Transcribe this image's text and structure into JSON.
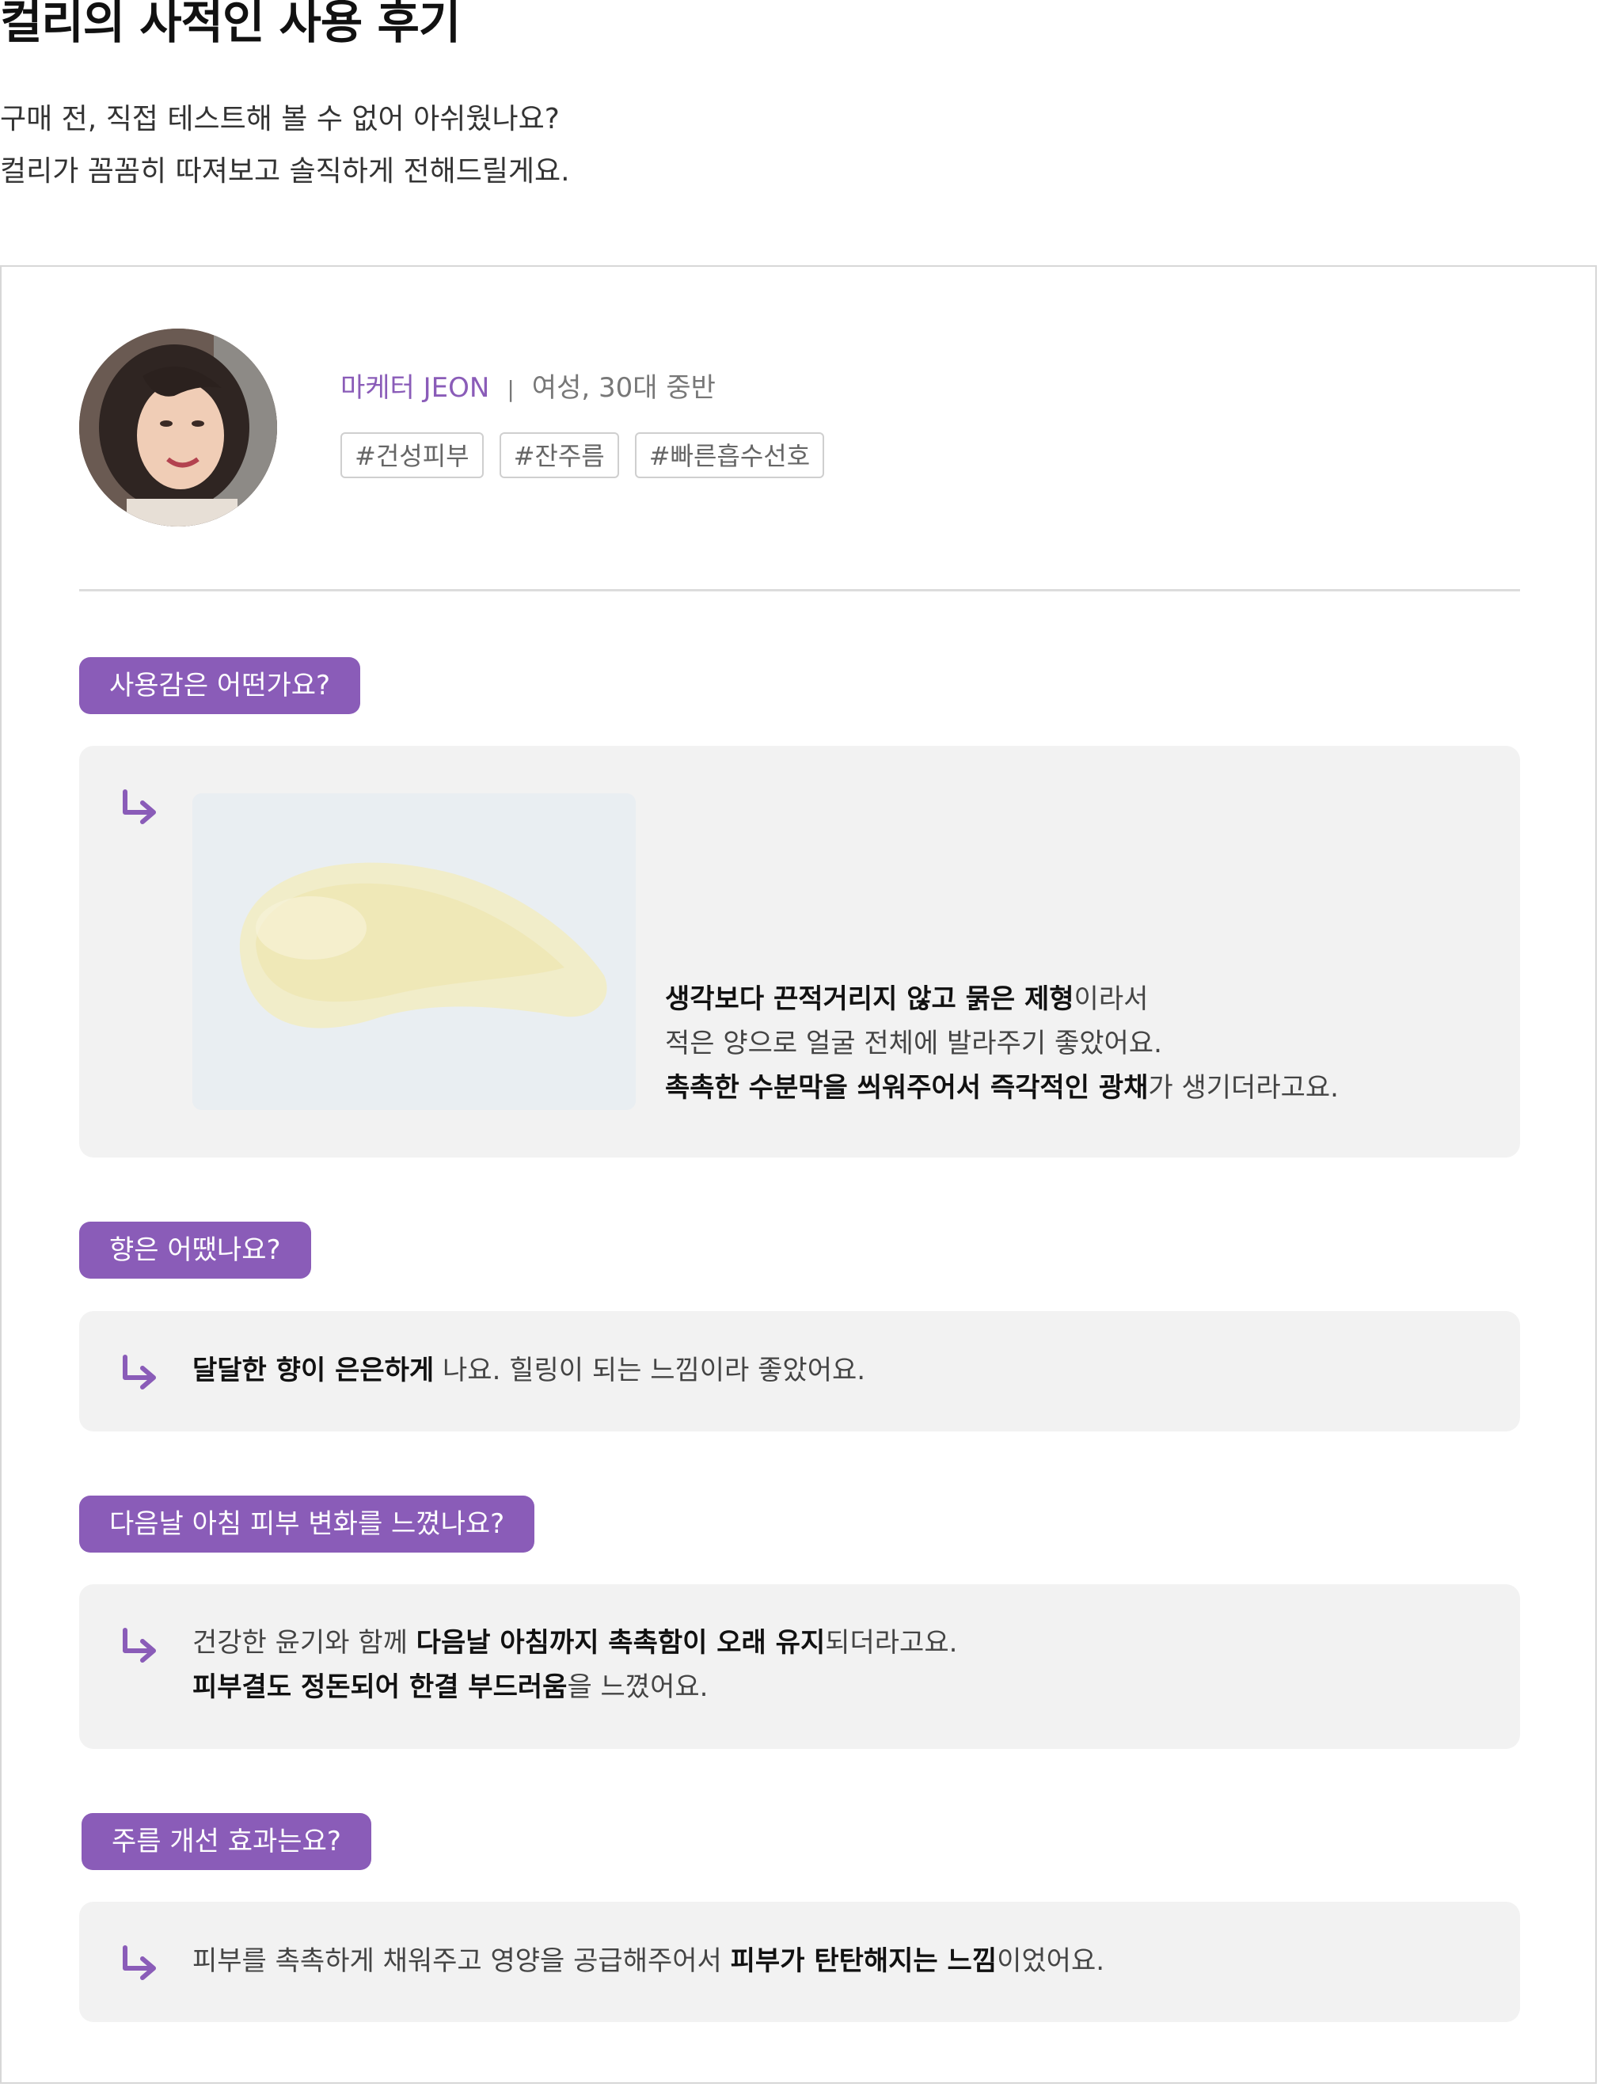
{
  "page": {
    "title": "컬리의 사적인 사용 후기",
    "intro": [
      "구매 전, 직접 테스트해 볼 수 없어 아쉬웠나요?",
      "컬리가 꼼꼼히 따져보고 솔직하게 전해드릴게요."
    ]
  },
  "reviewer": {
    "role": "마케터 JEON",
    "separator": "|",
    "meta": "여성, 30대 중반",
    "tags": [
      "#건성피부",
      "#잔주름",
      "#빠른흡수선호"
    ]
  },
  "colors": {
    "accent": "#8a5cb8",
    "answer_bg": "#f2f2f2",
    "border": "#d7d7d7"
  },
  "icons": {
    "answer_arrow": "arrow-down-right-icon"
  },
  "qa": [
    {
      "question": "사용감은 어떤가요?",
      "lines": [
        [
          {
            "t": "생각보다 끈적거리지 않고 묽은 제형",
            "b": true
          },
          {
            "t": "이라서",
            "b": false
          }
        ],
        [
          {
            "t": "적은 양으로 얼굴 전체에 발라주기 좋았어요.",
            "b": false
          }
        ],
        [
          {
            "t": "촉촉한 수분막을 씌워주어서 즉각적인 광채",
            "b": true
          },
          {
            "t": "가 생기더라고요.",
            "b": false
          }
        ]
      ]
    },
    {
      "question": "향은 어땠나요?",
      "lines": [
        [
          {
            "t": "달달한 향이 은은하게",
            "b": true
          },
          {
            "t": " 나요. 힐링이 되는 느낌이라 좋았어요.",
            "b": false
          }
        ]
      ]
    },
    {
      "question": "다음날 아침 피부 변화를 느꼈나요?",
      "lines": [
        [
          {
            "t": "건강한 윤기와 함께 ",
            "b": false
          },
          {
            "t": "다음날 아침까지 촉촉함이 오래 유지",
            "b": true
          },
          {
            "t": "되더라고요.",
            "b": false
          }
        ],
        [
          {
            "t": "피부결도 정돈되어 한결 부드러움",
            "b": true
          },
          {
            "t": "을 느꼈어요.",
            "b": false
          }
        ]
      ]
    },
    {
      "question": "주름 개선 효과는요?",
      "lines": [
        [
          {
            "t": "피부를 촉촉하게 채워주고 영양을 공급해주어서 ",
            "b": false
          },
          {
            "t": "피부가 탄탄해지는 느낌",
            "b": true
          },
          {
            "t": "이었어요.",
            "b": false
          }
        ]
      ]
    }
  ]
}
